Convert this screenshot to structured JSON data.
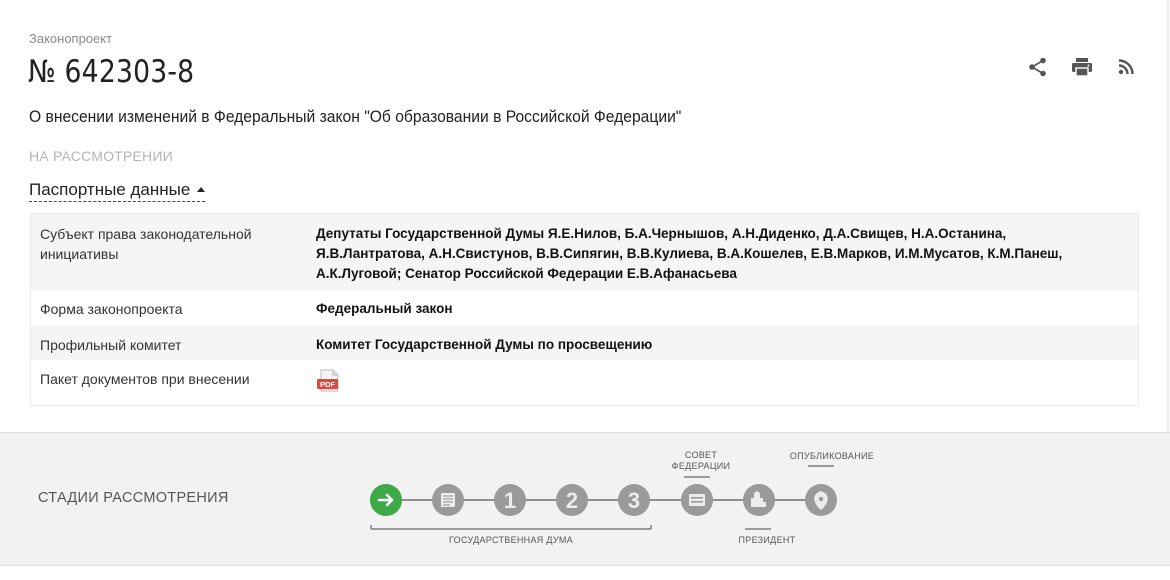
{
  "header": {
    "eyebrow": "Законопроект",
    "number": "№ 642303-8",
    "title": "О внесении изменений в Федеральный закон \"Об образовании в Российской Федерации\"",
    "status": "НА РАССМОТРЕНИИ",
    "passport_toggle": "Паспортные данные",
    "actions": [
      {
        "icon": "share-icon"
      },
      {
        "icon": "print-icon"
      },
      {
        "icon": "rss-icon"
      }
    ]
  },
  "passport": {
    "rows": [
      {
        "label": "Субъект права законодательной инициативы",
        "value": "Депутаты Государственной Думы Я.Е.Нилов, Б.А.Чернышов, А.Н.Диденко, Д.А.Свищев, Н.А.Останина, Я.В.Лантратова, А.Н.Свистунов, В.В.Сипягин, В.В.Кулиева, В.А.Кошелев, Е.В.Марков, И.М.Мусатов, К.М.Панеш, А.К.Луговой; Сенатор Российской Федерации Е.В.Афанасьева"
      },
      {
        "label": "Форма законопроекта",
        "value": "Федеральный закон"
      },
      {
        "label": "Профильный комитет",
        "value": "Комитет Государственной Думы по просвещению"
      },
      {
        "label": "Пакет документов при внесении",
        "value_icon": "pdf-icon",
        "icon_text": "PDF"
      }
    ]
  },
  "stages": {
    "title": "СТАДИИ РАССМОТРЕНИЯ",
    "steps": [
      {
        "name": "stage-arrow-icon",
        "active": true
      },
      {
        "name": "stage-list-icon",
        "active": false
      },
      {
        "name": "stage-reading-1",
        "text": "1",
        "active": false
      },
      {
        "name": "stage-reading-2",
        "text": "2",
        "active": false
      },
      {
        "name": "stage-reading-3",
        "text": "3",
        "active": false
      },
      {
        "name": "stage-federation-council-icon",
        "active": false
      },
      {
        "name": "stage-president-icon",
        "active": false
      },
      {
        "name": "stage-publication-icon",
        "active": false
      }
    ],
    "labels": {
      "duma": "ГОСУДАРСТВЕННАЯ ДУМА",
      "council_line1": "СОВЕТ",
      "council_line2": "ФЕДЕРАЦИИ",
      "president": "ПРЕЗИДЕНТ",
      "publication": "ОПУБЛИКОВАНИЕ"
    },
    "colors": {
      "active": "#3daa47",
      "inactive": "#9a9a9a",
      "line": "#6d6d6d"
    }
  }
}
